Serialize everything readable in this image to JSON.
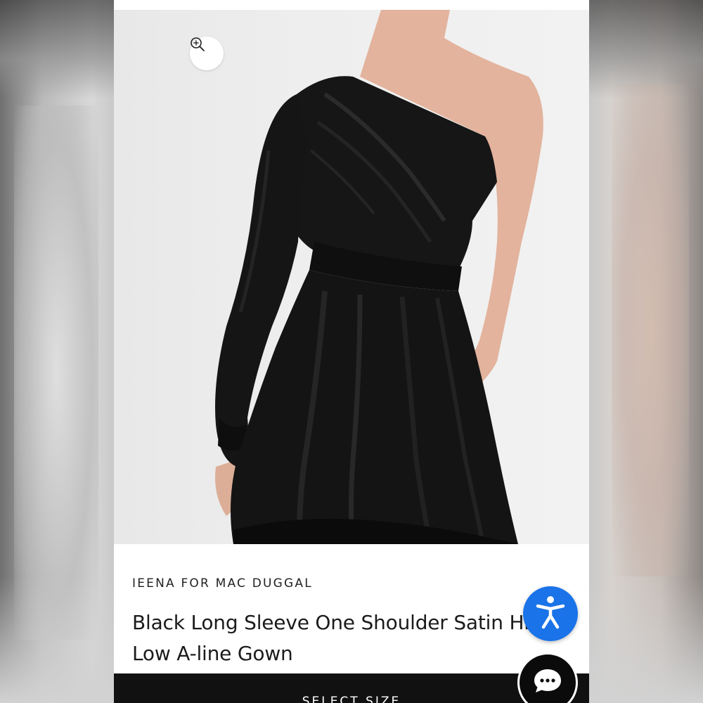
{
  "product": {
    "brand": "IEENA FOR MAC DUGGAL",
    "title": "Black Long Sleeve One Shoulder Satin High Low A-line Gown",
    "image_alt": "Model wearing black one shoulder satin gown"
  },
  "actions": {
    "select_size_label": "SELECT SIZE"
  },
  "icons": {
    "zoom": "zoom-in-icon",
    "accessibility": "accessibility-icon",
    "chat": "chat-icon"
  },
  "colors": {
    "accessibility_blue": "#1a73e8",
    "button_black": "#111111",
    "dress_black": "#141414"
  }
}
